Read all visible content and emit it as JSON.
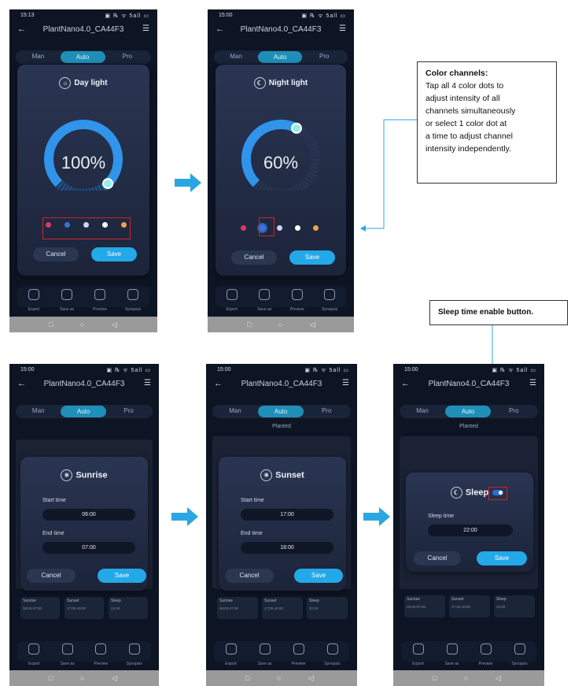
{
  "phone1": {
    "time": "15:13",
    "status_icons": "▣ ℞ ᯤ 5all ▭",
    "title": "PlantNano4.0_CA44F3",
    "tabs": [
      "Man",
      "Auto",
      "Pro"
    ],
    "dialog_title": "Day light",
    "percent": "100%",
    "cancel": "Cancel",
    "save": "Save",
    "nav": [
      "Export",
      "Save as",
      "Preview",
      "Synopsis"
    ],
    "colors": [
      "#d63b6c",
      "#3f6fe0",
      "#c9d5f5",
      "#ffffff",
      "#f0a14a"
    ],
    "level": 1.0
  },
  "phone2": {
    "time": "15:00",
    "status_icons": "▣ ℞ ᯤ 5all ▭",
    "title": "PlantNano4.0_CA44F3",
    "tabs": [
      "Man",
      "Auto",
      "Pro"
    ],
    "dialog_title": "Night light",
    "percent": "60%",
    "cancel": "Cancel",
    "save": "Save",
    "nav": [
      "Export",
      "Save as",
      "Preview",
      "Synopsis"
    ],
    "colors": [
      "#d63b6c",
      "#3f6fe0",
      "#c9d5f5",
      "#ffffff",
      "#f0a14a"
    ],
    "level": 0.6
  },
  "phone3": {
    "time": "15:00",
    "status_icons": "▣ ℞ ᯤ 5all ▭",
    "title": "PlantNano4.0_CA44F3",
    "tabs": [
      "Man",
      "Auto",
      "Pro"
    ],
    "dialog_title": "Sunrise",
    "start_label": "Start time",
    "start_value": "06:00",
    "end_label": "End time",
    "end_value": "07:00",
    "cancel": "Cancel",
    "save": "Save",
    "cards": [
      {
        "t": "Sunrise",
        "v": "06:00-07:00"
      },
      {
        "t": "Sunset",
        "v": "17:00-18:00"
      },
      {
        "t": "Sleep",
        "v": "22:00"
      }
    ],
    "nav": [
      "Export",
      "Save as",
      "Preview",
      "Synopsis"
    ]
  },
  "phone4": {
    "time": "15:00",
    "status_icons": "▣ ℞ ᯤ 5all ▭",
    "title": "PlantNano4.0_CA44F3",
    "tabs": [
      "Man",
      "Auto",
      "Pro"
    ],
    "subtitle": "Planted",
    "dialog_title": "Sunset",
    "start_label": "Start time",
    "start_value": "17:00",
    "end_label": "End time",
    "end_value": "18:00",
    "cancel": "Cancel",
    "save": "Save",
    "cards": [
      {
        "t": "Sunrise",
        "v": "06:00-07:00"
      },
      {
        "t": "Sunset",
        "v": "17:00-18:00"
      },
      {
        "t": "Sleep",
        "v": "22:00"
      }
    ],
    "nav": [
      "Export",
      "Save as",
      "Preview",
      "Synopsis"
    ]
  },
  "phone5": {
    "time": "15:00",
    "status_icons": "▣ ℞ ᯤ 5all ▭",
    "title": "PlantNano4.0_CA44F3",
    "tabs": [
      "Man",
      "Auto",
      "Pro"
    ],
    "subtitle": "Planted",
    "dialog_title": "Sleep",
    "sleep_label": "Sleep time",
    "sleep_value": "22:00",
    "cancel": "Cancel",
    "save": "Save",
    "cards": [
      {
        "t": "Sunrise",
        "v": "06:00-07:00"
      },
      {
        "t": "Sunset",
        "v": "17:00-18:00"
      },
      {
        "t": "Sleep",
        "v": "22:00"
      }
    ],
    "nav": [
      "Export",
      "Save as",
      "Preview",
      "Synopsis"
    ]
  },
  "callout_color": {
    "heading": "Color channels:",
    "lines": [
      "Tap all 4 color dots to",
      "adjust intensity of all",
      "channels simultaneously",
      "or select 1 color dot at",
      "a time to adjust channel",
      "intensity independently."
    ]
  },
  "callout_sleep": {
    "text": "Sleep time enable button."
  },
  "accent": "#2aa6e0",
  "highlight": "#c62828"
}
